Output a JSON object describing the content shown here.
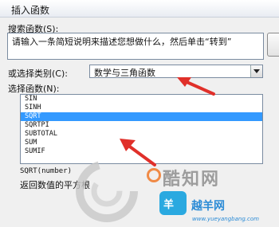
{
  "dialog": {
    "title": "插入函数"
  },
  "search": {
    "label": "搜索函数(S):",
    "value": "请输入一条简短说明来描述您想做什么，然后单击“转到”"
  },
  "category": {
    "label": "或选择类别(C):",
    "selected": "数学与三角函数"
  },
  "functions": {
    "label": "选择函数(N):",
    "items": [
      "SIN",
      "SINH",
      "SQRT",
      "SQRTPI",
      "SUBTOTAL",
      "SUM",
      "SUMIF"
    ],
    "selected": "SQRT"
  },
  "details": {
    "signature": "SQRT(number)",
    "description": "返回数值的平方根"
  },
  "annotations": {
    "arrow_color": "#e0302a",
    "arrow_count": 2
  },
  "watermarks": {
    "logo1_text": "酷知网",
    "logo2_text": "越羊网",
    "badge_text": "羊",
    "url": "www.yueyangbang.com"
  },
  "colors": {
    "selection": "#3399ff",
    "window_bg": "#f0f0f0",
    "border": "#7a8ba0"
  }
}
